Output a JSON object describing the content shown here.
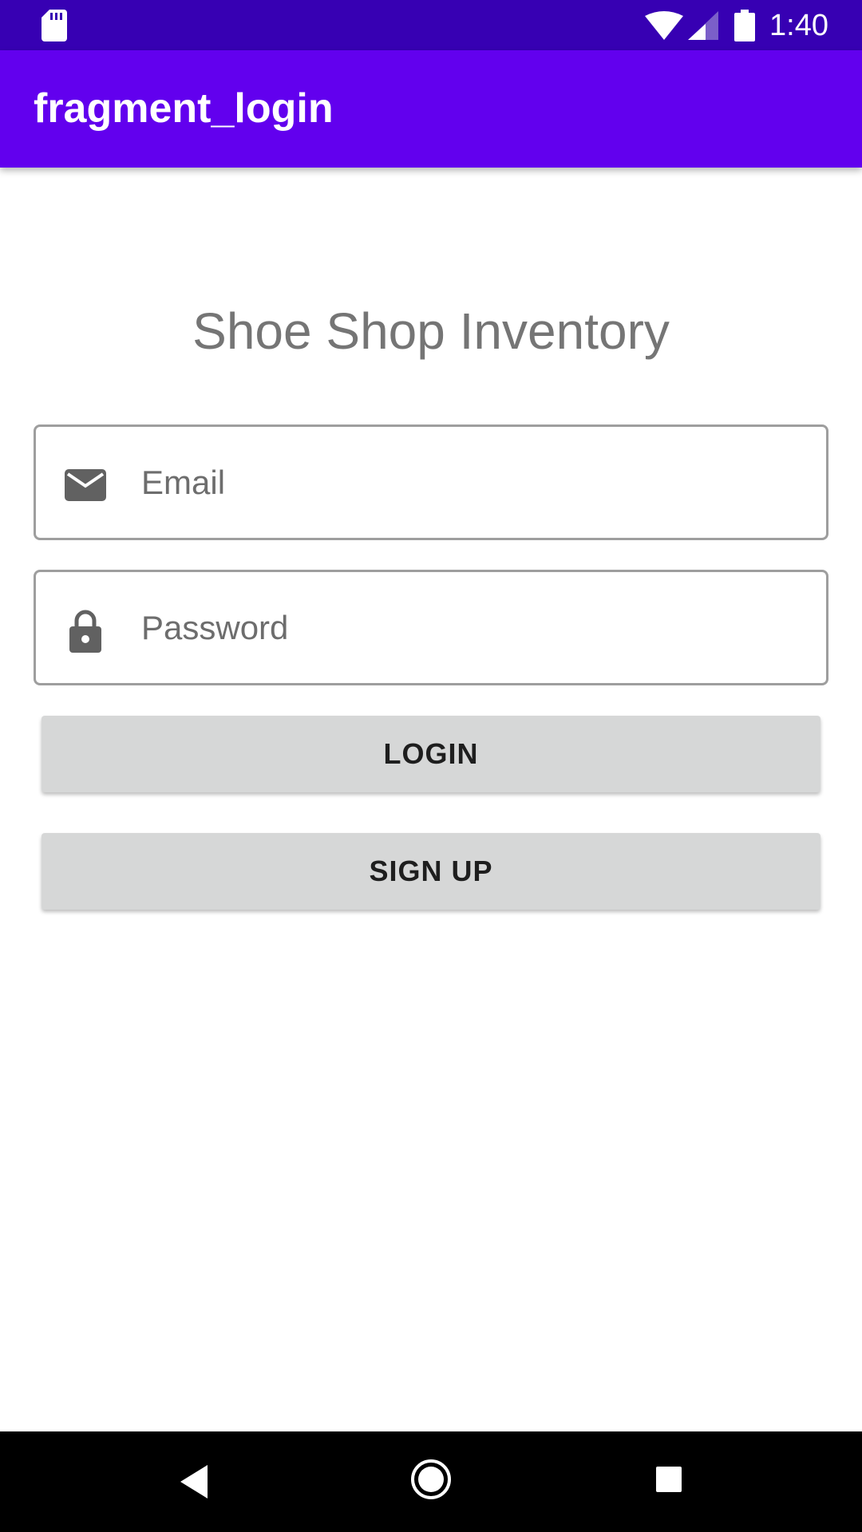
{
  "status_bar": {
    "time": "1:40",
    "icons": [
      "sd-card-icon",
      "wifi-icon",
      "cell-signal-icon",
      "battery-icon"
    ]
  },
  "app_bar": {
    "title": "fragment_login",
    "color": "#6200ee"
  },
  "main": {
    "heading": "Shoe Shop Inventory",
    "email_field": {
      "placeholder": "Email",
      "value": "",
      "icon": "email-icon"
    },
    "password_field": {
      "placeholder": "Password",
      "value": "",
      "icon": "lock-icon"
    },
    "login_button": "LOGIN",
    "signup_button": "SIGN UP"
  },
  "nav_bar": {
    "icons": [
      "back-icon",
      "home-icon",
      "recents-icon"
    ]
  },
  "colors": {
    "status_bar": "#3700b3",
    "primary": "#6200ee",
    "button_bg": "#d6d7d7",
    "heading_text": "#757575"
  }
}
